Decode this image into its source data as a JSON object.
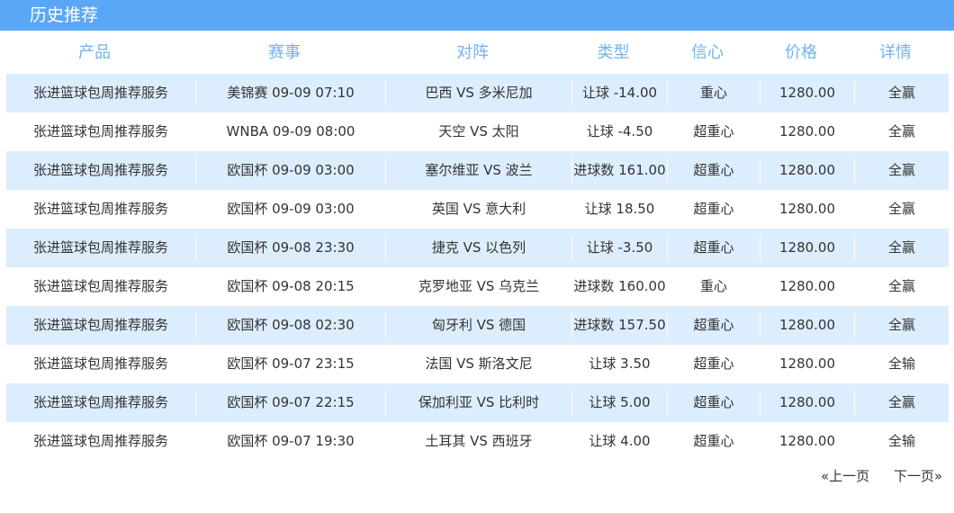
{
  "title": "历史推荐",
  "columns": [
    "产品",
    "赛事",
    "对阵",
    "类型",
    "信心",
    "价格",
    "详情"
  ],
  "rows": [
    [
      "张进篮球包周推荐服务",
      "美锦赛 09-09 07:10",
      "巴西 VS 多米尼加",
      "让球 -14.00",
      "重心",
      "1280.00",
      "全赢"
    ],
    [
      "张进篮球包周推荐服务",
      "WNBA 09-09 08:00",
      "天空 VS 太阳",
      "让球 -4.50",
      "超重心",
      "1280.00",
      "全赢"
    ],
    [
      "张进篮球包周推荐服务",
      "欧国杯 09-09 03:00",
      "塞尔维亚 VS 波兰",
      "进球数 161.00",
      "超重心",
      "1280.00",
      "全赢"
    ],
    [
      "张进篮球包周推荐服务",
      "欧国杯 09-09 03:00",
      "英国 VS 意大利",
      "让球 18.50",
      "超重心",
      "1280.00",
      "全赢"
    ],
    [
      "张进篮球包周推荐服务",
      "欧国杯 09-08 23:30",
      "捷克 VS 以色列",
      "让球 -3.50",
      "超重心",
      "1280.00",
      "全赢"
    ],
    [
      "张进篮球包周推荐服务",
      "欧国杯 09-08 20:15",
      "克罗地亚 VS 乌克兰",
      "进球数 160.00",
      "重心",
      "1280.00",
      "全赢"
    ],
    [
      "张进篮球包周推荐服务",
      "欧国杯 09-08 02:30",
      "匈牙利 VS 德国",
      "进球数 157.50",
      "超重心",
      "1280.00",
      "全赢"
    ],
    [
      "张进篮球包周推荐服务",
      "欧国杯 09-07 23:15",
      "法国 VS 斯洛文尼",
      "让球 3.50",
      "超重心",
      "1280.00",
      "全输"
    ],
    [
      "张进篮球包周推荐服务",
      "欧国杯 09-07 22:15",
      "保加利亚 VS 比利时",
      "让球 5.00",
      "超重心",
      "1280.00",
      "全赢"
    ],
    [
      "张进篮球包周推荐服务",
      "欧国杯 09-07 19:30",
      "土耳其 VS 西班牙",
      "让球 4.00",
      "超重心",
      "1280.00",
      "全输"
    ]
  ],
  "pagination": {
    "prev": "«上一页",
    "next": "下一页»"
  },
  "colors": {
    "title_bar": "#5aa7f8",
    "header_text": "#72b3f2",
    "row_alt": "#dcedfd",
    "text": "#333333"
  }
}
